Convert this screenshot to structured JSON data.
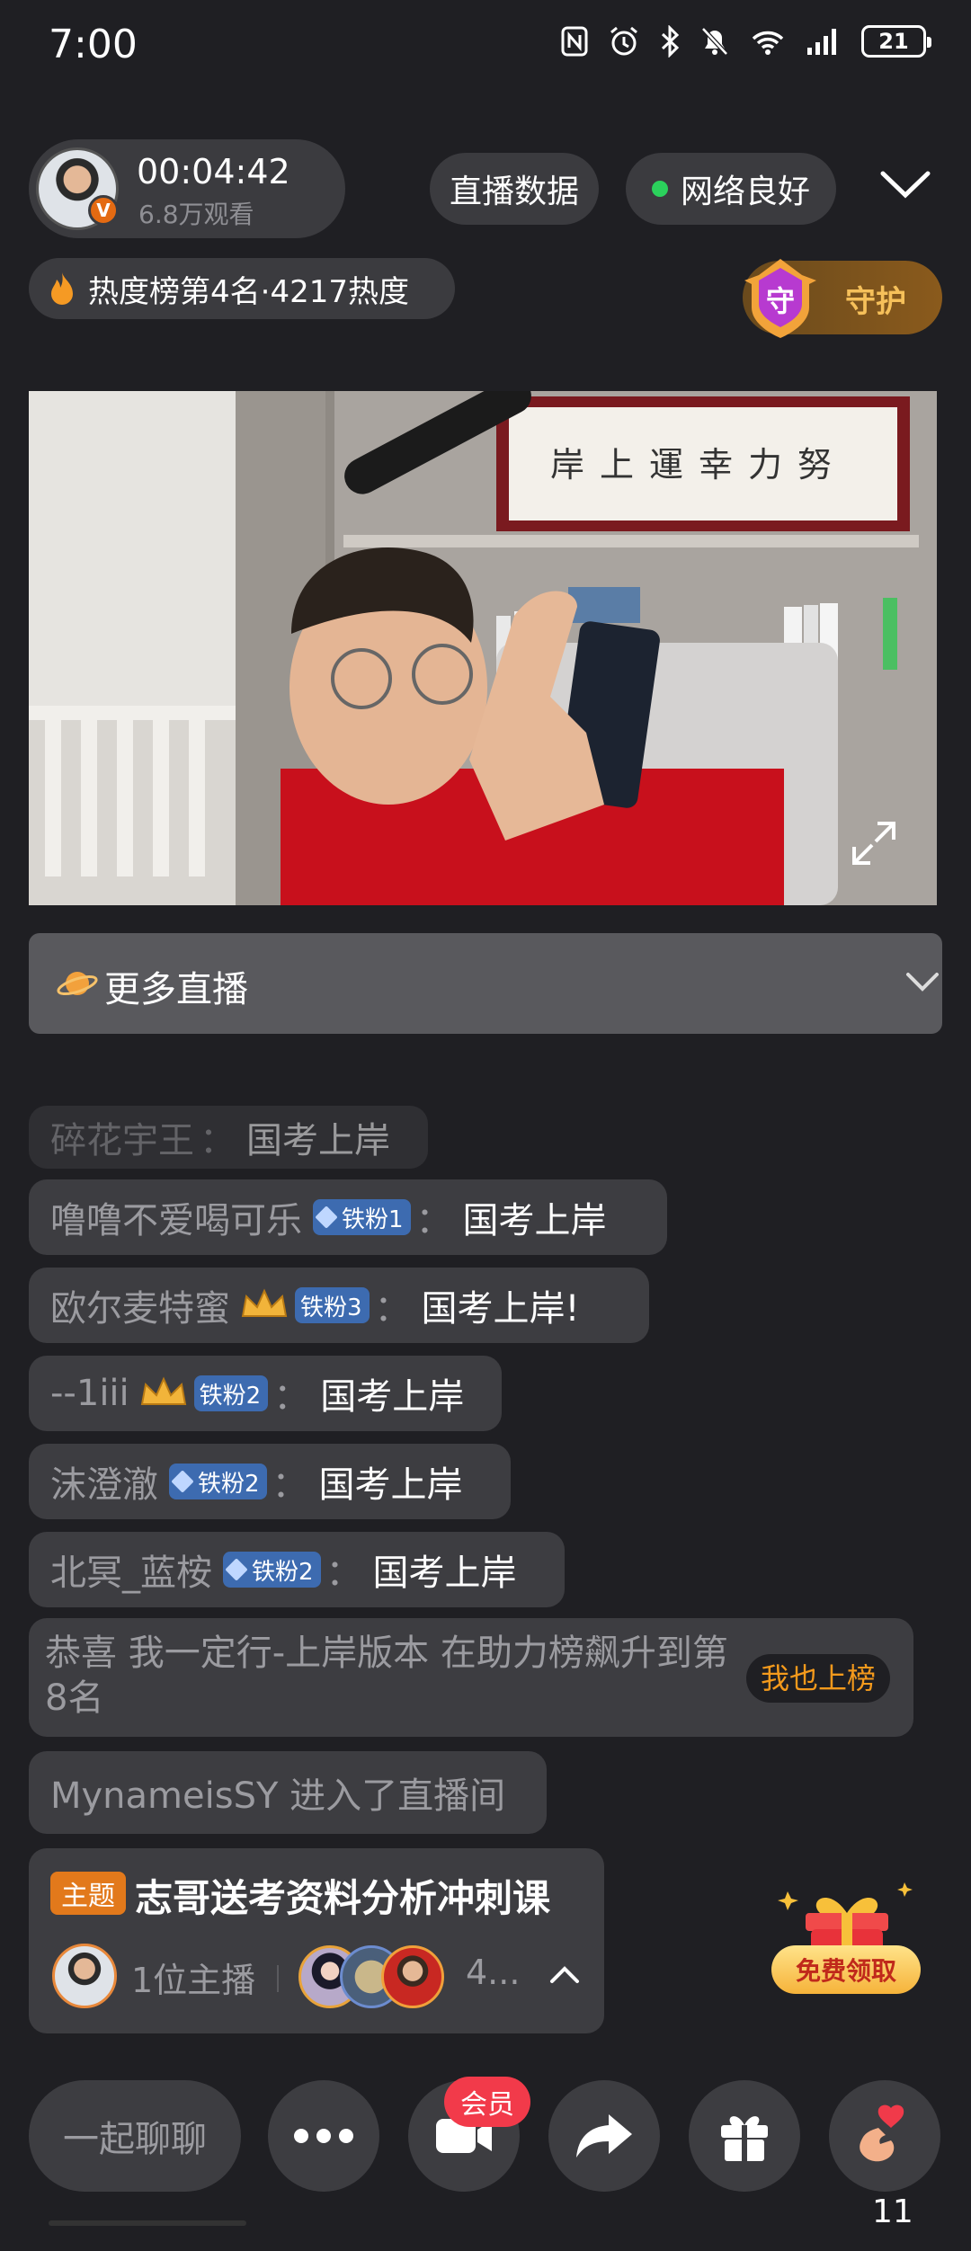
{
  "status_bar": {
    "time": "7:00",
    "battery": "21",
    "icons": [
      "nfc-icon",
      "alarm-icon",
      "bluetooth-icon",
      "mute-icon",
      "wifi-icon",
      "signal-icon",
      "battery-icon"
    ]
  },
  "host": {
    "timer": "00:04:42",
    "viewers": "6.8万观看",
    "badge": "V"
  },
  "header": {
    "live_data_label": "直播数据",
    "network_label": "网络良好",
    "heat_label": "热度榜第4名·4217热度",
    "guard_icon_char": "守",
    "guard_label": "守护"
  },
  "more_live": {
    "label": "更多直播"
  },
  "chat": [
    {
      "user": "碎花宇王",
      "badge": "",
      "msg": "国考上岸"
    },
    {
      "user": "噜噜不爱喝可乐",
      "badge": "铁粉1",
      "msg": "国考上岸"
    },
    {
      "user": "欧尔麦特蜜",
      "badge": "铁粉3",
      "msg": "国考上岸!"
    },
    {
      "user": "--1iii",
      "badge": "铁粉2",
      "msg": "国考上岸"
    },
    {
      "user": "沫澄澈",
      "badge": "铁粉2",
      "msg": "国考上岸"
    },
    {
      "user": "北冥_蓝桉",
      "badge": "铁粉2",
      "msg": "国考上岸"
    }
  ],
  "chat_sep": "：",
  "congrats": {
    "text": "恭喜 我一定行-上岸版本 在助力榜飙升到第8名",
    "button": "我也上榜"
  },
  "join_notice": "MynameisSY 进入了直播间",
  "topic": {
    "tag": "主题",
    "title": "志哥送考资料分析冲刺课",
    "hosts": "1位主播",
    "more": "4..."
  },
  "gift_claim": "免费领取",
  "bottom_bar": {
    "chat_placeholder": "一起聊聊",
    "member_badge": "会员",
    "like_count": "11"
  },
  "colors": {
    "background": "#1f1f23",
    "pill": "#3b3b3f",
    "accent_orange": "#e2791b",
    "network_green": "#2bd15c",
    "fan_badge_blue": "#3d6bb0",
    "member_red": "#f23a4a"
  }
}
